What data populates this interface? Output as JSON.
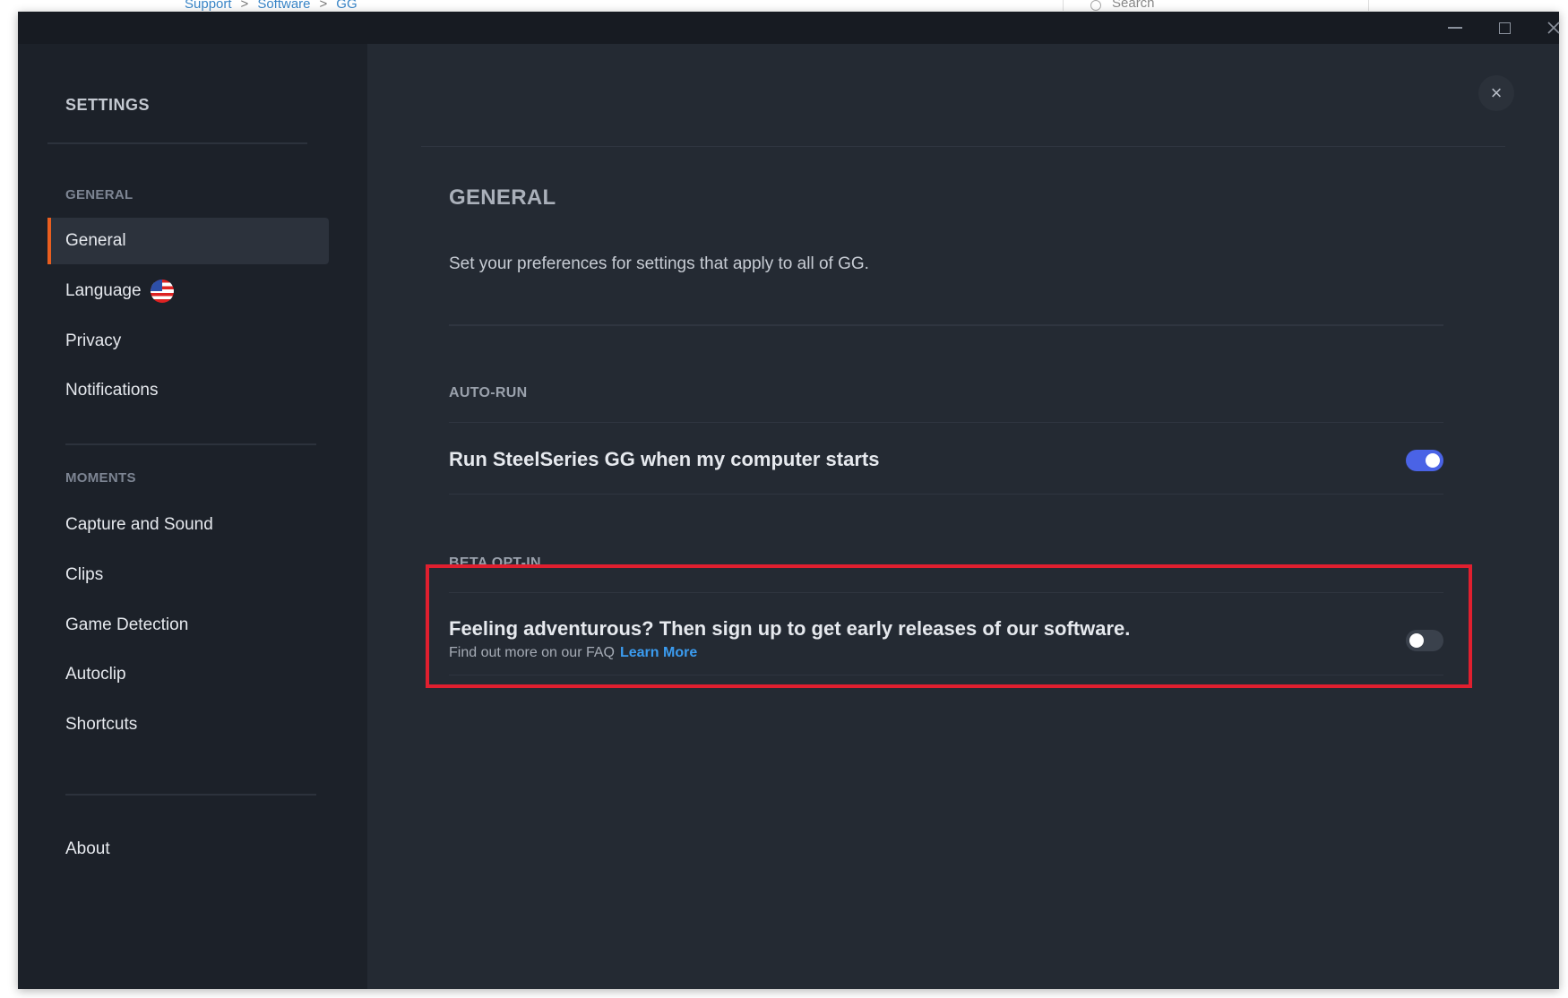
{
  "background_page": {
    "breadcrumb": [
      "Support",
      "Software",
      "GG"
    ],
    "breadcrumb_separator": ">",
    "search_placeholder": "Search"
  },
  "window": {
    "controls": [
      "minimize-icon",
      "maximize-icon",
      "close-icon"
    ]
  },
  "sidebar": {
    "title": "SETTINGS",
    "sections": [
      {
        "label": "GENERAL",
        "items": [
          {
            "label": "General",
            "active": true
          },
          {
            "label": "Language",
            "icon": "us-flag-icon"
          },
          {
            "label": "Privacy"
          },
          {
            "label": "Notifications"
          }
        ]
      },
      {
        "label": "MOMENTS",
        "items": [
          {
            "label": "Capture and Sound"
          },
          {
            "label": "Clips"
          },
          {
            "label": "Game Detection"
          },
          {
            "label": "Autoclip"
          },
          {
            "label": "Shortcuts"
          }
        ]
      },
      {
        "items": [
          {
            "label": "About"
          }
        ]
      }
    ]
  },
  "main": {
    "close_icon": "×",
    "title": "GENERAL",
    "description": "Set your preferences for settings that apply to all of GG.",
    "auto_run": {
      "section_label": "AUTO-RUN",
      "setting_label": "Run SteelSeries GG when my computer starts",
      "enabled": true
    },
    "beta": {
      "section_label": "BETA OPT-IN",
      "setting_label": "Feeling adventurous? Then sign up to get early releases of our software.",
      "subtext": "Find out more on our FAQ",
      "link_text": "Learn More",
      "enabled": false
    }
  },
  "colors": {
    "accent_active": "#e95e1f",
    "toggle_on": "#4a63e6",
    "link": "#3b9cf0",
    "highlight_box": "#e01f2f"
  }
}
